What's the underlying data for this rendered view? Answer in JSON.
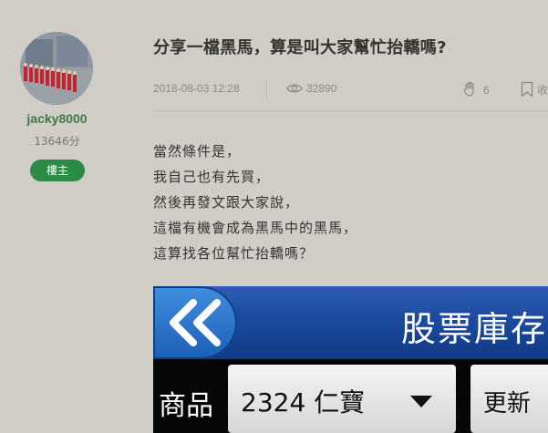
{
  "author": {
    "name": "jacky8000",
    "score": "13646分",
    "badge": "樓主"
  },
  "post": {
    "title": "分享一檔黑馬，算是叫大家幫忙抬轎嗎?",
    "date": "2018-08-03 12:28",
    "views": "32890",
    "likes": "6",
    "collect_label": "收藏",
    "content": [
      "當然條件是，",
      "我自己也有先買，",
      "然後再發文跟大家說，",
      "這檔有機會成為黑馬中的黑馬，",
      "這算找各位幫忙抬轎嗎？"
    ]
  },
  "embedded_image": {
    "banner_title": "股票庫存",
    "product_label": "商品",
    "product_value": "2324 仁寶",
    "refresh_label": "更新"
  },
  "icons": {
    "views": "eye-icon",
    "likes": "clap-hand-icon",
    "collect": "bookmark-icon",
    "back": "double-chevron-left-icon",
    "select": "caret-down-icon"
  },
  "colors": {
    "background": "#d0cdc7",
    "author_name": "#3d7a43",
    "badge": "#2e8b47",
    "banner": "#1b4aa0"
  }
}
